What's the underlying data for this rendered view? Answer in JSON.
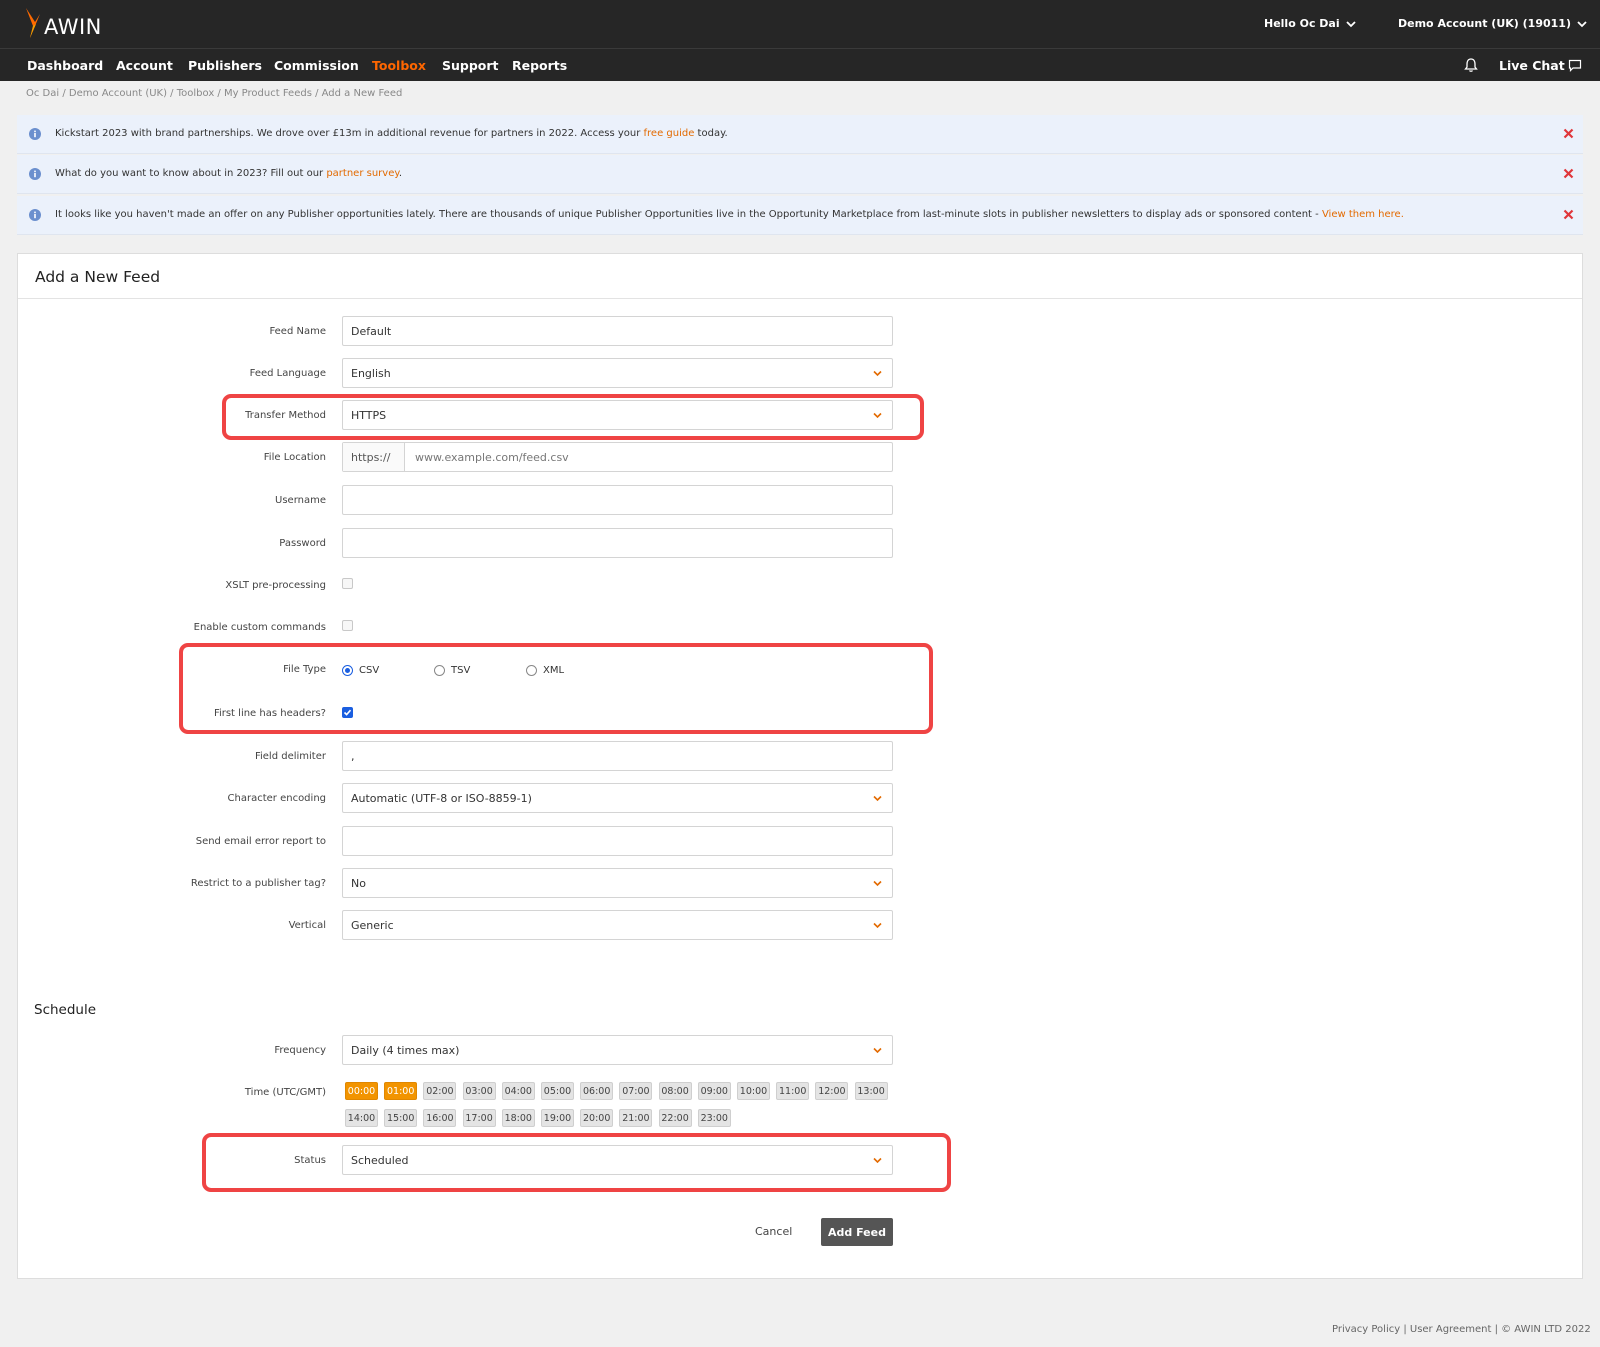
{
  "header": {
    "logo_text": "AWIN",
    "greeting": "Hello Oc Dai",
    "account": "Demo Account (UK) (19011)"
  },
  "nav": {
    "items": [
      "Dashboard",
      "Account",
      "Publishers",
      "Commission",
      "Toolbox",
      "Support",
      "Reports"
    ],
    "active": "Toolbox",
    "live_chat": "Live Chat"
  },
  "breadcrumb": "Oc Dai / Demo Account (UK) / Toolbox / My Product Feeds / Add a New Feed",
  "notices": [
    {
      "text": "Kickstart 2023 with brand partnerships. We drove over £13m in additional revenue for partners in 2022. Access your ",
      "link": "free guide",
      "after": " today."
    },
    {
      "text": "What do you want to know about in 2023? Fill out our ",
      "link": "partner survey",
      "after": "."
    },
    {
      "text": "It looks like you haven't made an offer on any Publisher opportunities lately. There are thousands of unique Publisher Opportunities live in the Opportunity Marketplace from last-minute slots in publisher newsletters to display ads or sponsored content - ",
      "link": "View them here.",
      "after": ""
    }
  ],
  "form": {
    "title": "Add a New Feed",
    "feed_name": {
      "label": "Feed Name",
      "value": "Default"
    },
    "feed_language": {
      "label": "Feed Language",
      "value": "English"
    },
    "transfer_method": {
      "label": "Transfer Method",
      "value": "HTTPS"
    },
    "file_location": {
      "label": "File Location",
      "prefix": "https://",
      "placeholder": "www.example.com/feed.csv"
    },
    "username": {
      "label": "Username",
      "value": ""
    },
    "password": {
      "label": "Password",
      "value": ""
    },
    "xslt": {
      "label": "XSLT pre-processing",
      "checked": false
    },
    "custom_commands": {
      "label": "Enable custom commands",
      "checked": false
    },
    "file_type": {
      "label": "File Type",
      "options": [
        "CSV",
        "TSV",
        "XML"
      ],
      "selected": "CSV"
    },
    "first_line_headers": {
      "label": "First line has headers?",
      "checked": true
    },
    "field_delimiter": {
      "label": "Field delimiter",
      "value": ","
    },
    "character_encoding": {
      "label": "Character encoding",
      "value": "Automatic (UTF-8 or ISO-8859-1)"
    },
    "error_email": {
      "label": "Send email error report to",
      "value": ""
    },
    "publisher_tag": {
      "label": "Restrict to a publisher tag?",
      "value": "No"
    },
    "vertical": {
      "label": "Vertical",
      "value": "Generic"
    }
  },
  "schedule": {
    "title": "Schedule",
    "frequency": {
      "label": "Frequency",
      "value": "Daily (4 times max)"
    },
    "time": {
      "label": "Time (UTC/GMT)",
      "slots": [
        "00:00",
        "01:00",
        "02:00",
        "03:00",
        "04:00",
        "05:00",
        "06:00",
        "07:00",
        "08:00",
        "09:00",
        "10:00",
        "11:00",
        "12:00",
        "13:00",
        "14:00",
        "15:00",
        "16:00",
        "17:00",
        "18:00",
        "19:00",
        "20:00",
        "21:00",
        "22:00",
        "23:00"
      ],
      "selected": [
        "00:00",
        "01:00"
      ]
    },
    "status": {
      "label": "Status",
      "value": "Scheduled"
    }
  },
  "actions": {
    "cancel": "Cancel",
    "submit": "Add Feed"
  },
  "footer": "Privacy Policy | User Agreement | © AWIN LTD 2022",
  "colors": {
    "accent": "#ff6600",
    "highlight": "#ef4444",
    "time_selected": "#f29400"
  }
}
